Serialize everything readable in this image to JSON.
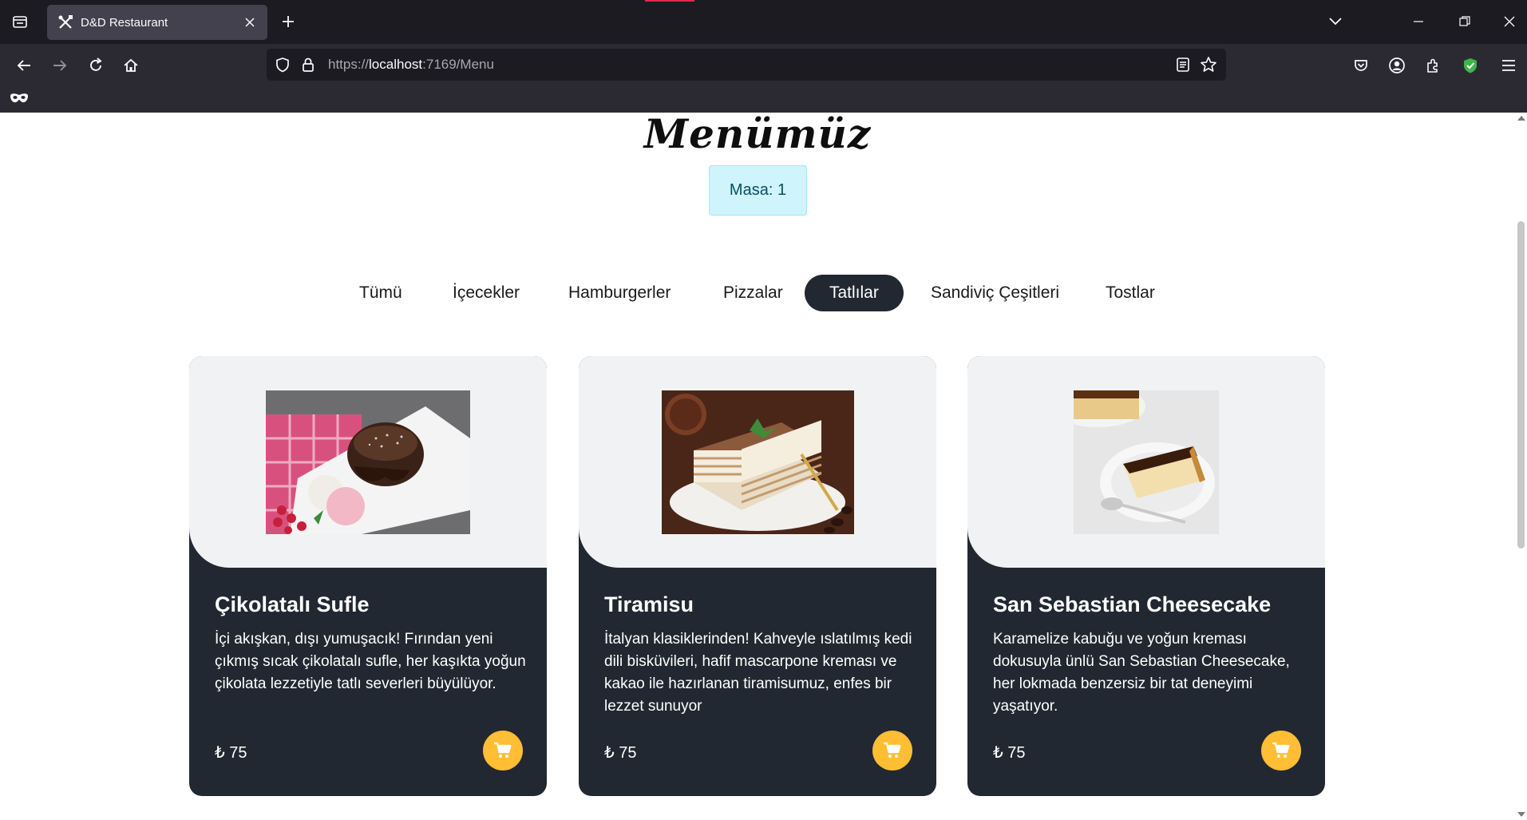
{
  "browser": {
    "tab_title": "D&D Restaurant",
    "url_scheme": "https://",
    "url_host": "localhost",
    "url_port_path": ":7169/Menu",
    "icons": [
      "tab-list-icon",
      "close-icon",
      "new-tab-icon",
      "list-tabs-icon",
      "minimize-icon",
      "restore-icon",
      "window-close-icon",
      "back-icon",
      "forward-icon",
      "reload-icon",
      "home-icon",
      "shield-icon",
      "lock-icon",
      "reader-view-icon",
      "bookmark-star-icon",
      "pocket-icon",
      "account-icon",
      "extensions-icon",
      "adblock-icon",
      "menu-icon",
      "private-mask-icon"
    ]
  },
  "page": {
    "heading": "Menümüz",
    "table_label": "Masa: 1",
    "filters": [
      "Tümü",
      "İçecekler",
      "Hamburgerler",
      "Pizzalar",
      "Tatlılar",
      "Sandiviç Çeşitleri",
      "Tostlar"
    ],
    "active_filter": "Tatlılar",
    "accent_color": "#ffbe33",
    "card_color": "#222831",
    "items": [
      {
        "name": "Çikolatalı Sufle",
        "description": "İçi akışkan, dışı yumuşacık! Fırından yeni çıkmış sıcak çikolatalı sufle, her kaşıkta yoğun çikolata lezzetiyle tatlı severleri büyülüyor.",
        "price": "₺ 75"
      },
      {
        "name": "Tiramisu",
        "description": "İtalyan klasiklerinden! Kahveyle ıslatılmış kedi dili bisküvileri, hafif mascarpone kreması ve kakao ile hazırlanan tiramisumuz, enfes bir lezzet sunuyor",
        "price": "₺ 75"
      },
      {
        "name": "San Sebastian Cheesecake",
        "description": "Karamelize kabuğu ve yoğun kreması dokusuyla ünlü San Sebastian Cheesecake, her lokmada benzersiz bir tat deneyimi yaşatıyor.",
        "price": "₺ 75"
      }
    ]
  }
}
